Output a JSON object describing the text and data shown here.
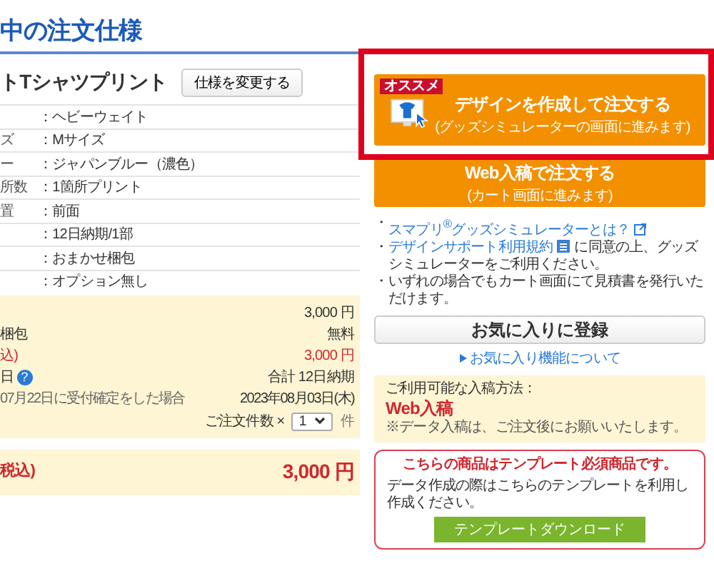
{
  "title": "中の注文仕様",
  "product": {
    "name": "トTシャツプリント",
    "change_button": "仕様を変更する"
  },
  "specs": [
    {
      "value": "：ヘビーウェイト"
    },
    {
      "label": "ズ",
      "value": "：Mサイズ"
    },
    {
      "label": "ー",
      "value": "：ジャパンブルー（濃色）"
    },
    {
      "label": "所数",
      "value": "：1箇所プリント"
    },
    {
      "label": "置",
      "value": "：前面"
    },
    {
      "value": "：12日納期/1部"
    },
    {
      "value": "：おまかせ梱包"
    },
    {
      "value": "：オプション無し"
    }
  ],
  "price_rows": [
    {
      "kind": "plain",
      "value": "3,000 円"
    },
    {
      "kind": "plain",
      "label": "梱包",
      "value": "無料"
    },
    {
      "kind": "red",
      "label": "込)",
      "value": "3,000 円"
    },
    {
      "kind": "help",
      "label": "日",
      "value": "合計 12日納期",
      "help_icon": "?"
    },
    {
      "kind": "small",
      "label": "07月22日に受付確定をした場合",
      "value": "2023年08月03日(木)"
    }
  ],
  "quantity": {
    "label": "ご注文件数 ×",
    "value": "1",
    "unit": "件"
  },
  "total": {
    "label": "税込)",
    "value": "3,000 円"
  },
  "design_button": {
    "badge": "オススメ",
    "title": "デザインを作成して注文する",
    "subtitle": "(グッズシミュレーターの画面に進みます)"
  },
  "web_button": {
    "title": "Web入稿で注文する",
    "subtitle": "(カート画面に進みます)"
  },
  "notes": [
    {
      "bullet": "・",
      "link": "スマプリ$^{®}$グッズシミュレーターとは？"
    },
    {
      "bullet": "・",
      "link": "デザインサポート利用規約",
      "rest": "に同意の上、グッズシミュレーターをご利用ください。"
    },
    {
      "bullet": "・",
      "rest": "いずれの場合でもカート画面にて見積書を発行いただけます。"
    }
  ],
  "favorite_button": "お気に入りに登録",
  "favorite_link": "お気に入り機能について",
  "upload": {
    "heading": "ご利用可能な入稿方法：",
    "method": "Web入稿",
    "note": "※データ入稿は、ご注文後にお願いいたします。"
  },
  "template": {
    "heading": "こちらの商品はテンプレート必須商品です。",
    "text": "データ作成の際はこちらのテンプレートを利用し作成ください。",
    "button": "テンプレートダウンロード"
  }
}
